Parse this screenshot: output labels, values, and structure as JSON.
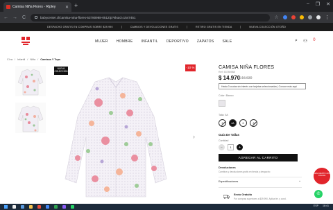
{
  "browser": {
    "tab_title": "Camisa Niña Flores - Ripley",
    "tab_close": "✕",
    "new_tab": "+",
    "window_controls": [
      "–",
      "❐",
      "✕"
    ],
    "nav_back": "←",
    "nav_forward": "→",
    "nav_reload": "C",
    "url": "babycenter.cl/camisa-nina-flores-53780988-0512/p?skuId=1547451",
    "star": "☆"
  },
  "promo_bar": {
    "items": [
      "DESPACHO GRATIS EN COMPRAS SOBRE $39.990",
      "CAMBIOS Y DEVOLUCIONES GRATIS",
      "RETIRO GRATIS EN TIENDA",
      "NUEVA COLECCIÓN OTOÑO"
    ]
  },
  "header": {
    "nav": [
      "MUJER",
      "HOMBRE",
      "INFANTIL",
      "DEPORTIVO",
      "ZAPATOS",
      "SALE"
    ],
    "search_icon": "⌕",
    "user_icon": "⚇",
    "bag_icon": "⊕",
    "bag_count": "0"
  },
  "breadcrumb": [
    "Cl.ra",
    "/",
    "Infantil",
    "/",
    "Niña",
    "/",
    "Camisas Y Tops"
  ],
  "gallery": {
    "new_tag": "NUEVA COLECCIÓN",
    "discount": "-10 %",
    "next_arrow": "›"
  },
  "product": {
    "name": "CAMISA NIÑA FLORES",
    "sku": "Ref: 53780988",
    "price": "$ 14.970",
    "old_price": "$ 16.630",
    "installments": "Hasta 3 cuotas sin interés con tarjetas seleccionadas | Conoce más aquí",
    "color_label": "Color: Blanco",
    "size_label": "Talla: 5A",
    "sizes": [
      "2",
      "4A",
      "6",
      "8"
    ],
    "size_guide": "Guía De Tallas",
    "qty_label": "Cantidad",
    "qty_minus": "−",
    "qty_value": "1",
    "qty_plus": "+",
    "add_to_cart": "AGREGAR AL CARRITO",
    "returns_title": "Devoluciones",
    "returns_sub": "Cambios y devoluciones gratis en tienda y despacho",
    "specs_label": "Especificaciones",
    "specs_arrow": "⌄",
    "shipping_title": "Envío Gratuito",
    "shipping_sub": "Por compras superiores a $39.990. Aplica tér. y cond."
  },
  "floating": {
    "promo_badge": "DESCUENTO 20% ONLINE",
    "whatsapp": "✆"
  },
  "taskbar": {
    "time": "18:41",
    "lang": "ESP"
  }
}
